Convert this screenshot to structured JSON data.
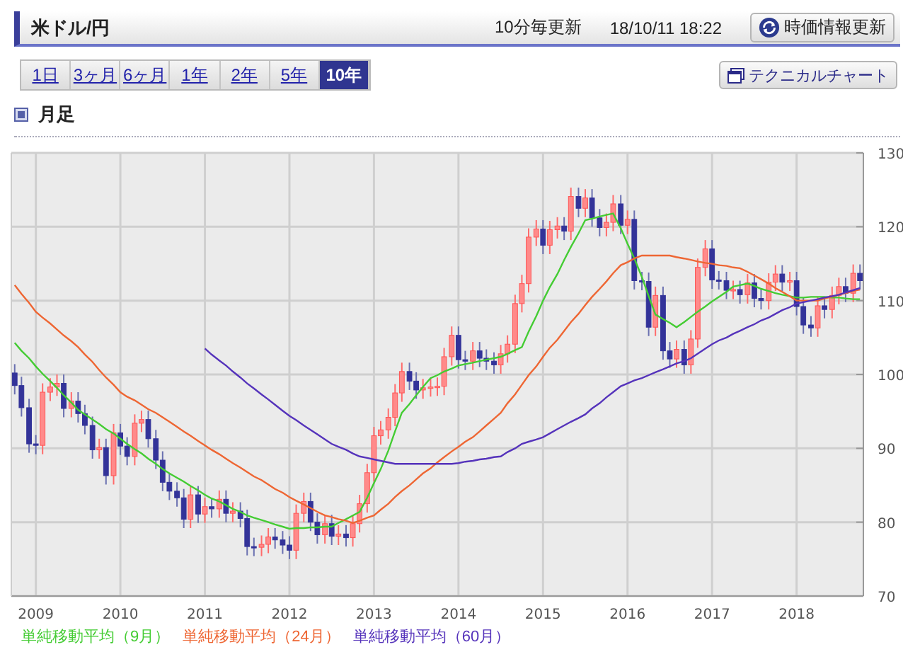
{
  "header": {
    "title": "米ドル/円",
    "update_interval": "10分毎更新",
    "timestamp": "18/10/11 18:22",
    "refresh_button": "時価情報更新"
  },
  "periods": [
    {
      "label": "1日",
      "selected": false
    },
    {
      "label": "3ヶ月",
      "selected": false
    },
    {
      "label": "6ヶ月",
      "selected": false
    },
    {
      "label": "1年",
      "selected": false
    },
    {
      "label": "2年",
      "selected": false
    },
    {
      "label": "5年",
      "selected": false
    },
    {
      "label": "10年",
      "selected": true
    }
  ],
  "technical_button": "テクニカルチャート",
  "section_title": "月足",
  "chart": {
    "chart_data": {
      "type": "candlestick",
      "grid": true,
      "xlim": [
        2008.71,
        2018.79
      ],
      "ylim": [
        70,
        130
      ],
      "xticks": [
        2009,
        2010,
        2011,
        2012,
        2013,
        2014,
        2015,
        2016,
        2017,
        2018
      ],
      "yticks": [
        70,
        80,
        90,
        100,
        110,
        120,
        130
      ],
      "x": [
        2008.75,
        2008.83,
        2008.92,
        2009,
        2009.08,
        2009.17,
        2009.25,
        2009.33,
        2009.42,
        2009.5,
        2009.58,
        2009.67,
        2009.75,
        2009.83,
        2009.92,
        2010,
        2010.08,
        2010.17,
        2010.25,
        2010.33,
        2010.42,
        2010.5,
        2010.58,
        2010.67,
        2010.75,
        2010.83,
        2010.92,
        2011,
        2011.08,
        2011.17,
        2011.25,
        2011.33,
        2011.42,
        2011.5,
        2011.58,
        2011.67,
        2011.75,
        2011.83,
        2011.92,
        2012,
        2012.08,
        2012.17,
        2012.25,
        2012.33,
        2012.42,
        2012.5,
        2012.58,
        2012.67,
        2012.75,
        2012.83,
        2012.92,
        2013,
        2013.08,
        2013.17,
        2013.25,
        2013.33,
        2013.42,
        2013.5,
        2013.58,
        2013.67,
        2013.75,
        2013.83,
        2013.92,
        2014,
        2014.08,
        2014.17,
        2014.25,
        2014.33,
        2014.42,
        2014.5,
        2014.58,
        2014.67,
        2014.75,
        2014.83,
        2014.92,
        2015,
        2015.08,
        2015.17,
        2015.25,
        2015.33,
        2015.42,
        2015.5,
        2015.58,
        2015.67,
        2015.75,
        2015.83,
        2015.92,
        2016,
        2016.08,
        2016.17,
        2016.25,
        2016.33,
        2016.42,
        2016.5,
        2016.58,
        2016.67,
        2016.75,
        2016.83,
        2016.92,
        2017,
        2017.08,
        2017.17,
        2017.25,
        2017.33,
        2017.42,
        2017.5,
        2017.58,
        2017.67,
        2017.75,
        2017.83,
        2017.92,
        2018,
        2018.08,
        2018.17,
        2018.25,
        2018.33,
        2018.42,
        2018.5,
        2018.58,
        2018.67,
        2018.75
      ],
      "ohlc": [
        [
          100.2,
          101.4,
          97.3,
          98.5
        ],
        [
          98.5,
          99.7,
          94.3,
          95.5
        ],
        [
          95.5,
          96.7,
          89.4,
          90.6
        ],
        [
          90.6,
          91.8,
          89.2,
          90.4
        ],
        [
          90.4,
          98.8,
          89.2,
          97.6
        ],
        [
          97.6,
          99.5,
          96.4,
          98.3
        ],
        [
          98.3,
          100.0,
          97.1,
          98.8
        ],
        [
          98.8,
          100.0,
          94.2,
          95.4
        ],
        [
          95.4,
          97.6,
          94.2,
          96.4
        ],
        [
          96.4,
          97.6,
          93.5,
          94.7
        ],
        [
          94.7,
          95.9,
          91.9,
          93.1
        ],
        [
          93.1,
          94.3,
          88.6,
          89.8
        ],
        [
          89.8,
          91.3,
          88.6,
          90.1
        ],
        [
          90.1,
          91.3,
          85.1,
          86.3
        ],
        [
          86.3,
          93.3,
          85.1,
          92.1
        ],
        [
          92.1,
          93.3,
          89.1,
          90.3
        ],
        [
          90.3,
          91.5,
          87.7,
          88.9
        ],
        [
          88.9,
          94.6,
          87.7,
          93.4
        ],
        [
          93.4,
          95.1,
          92.2,
          93.9
        ],
        [
          93.9,
          95.1,
          90.1,
          91.3
        ],
        [
          91.3,
          92.5,
          87.2,
          88.4
        ],
        [
          88.4,
          89.6,
          84.2,
          85.4
        ],
        [
          85.4,
          86.6,
          83.0,
          84.2
        ],
        [
          84.2,
          85.4,
          82.1,
          83.3
        ],
        [
          83.3,
          84.5,
          79.2,
          80.4
        ],
        [
          80.4,
          84.9,
          79.2,
          83.7
        ],
        [
          83.7,
          84.9,
          79.9,
          81.1
        ],
        [
          81.1,
          83.3,
          79.9,
          82.1
        ],
        [
          82.1,
          83.3,
          80.6,
          81.8
        ],
        [
          81.8,
          84.3,
          80.6,
          83.1
        ],
        [
          83.1,
          84.3,
          80.0,
          81.2
        ],
        [
          81.2,
          82.7,
          80.0,
          81.5
        ],
        [
          81.5,
          82.7,
          79.3,
          80.5
        ],
        [
          80.5,
          81.7,
          75.5,
          76.7
        ],
        [
          76.7,
          77.9,
          75.4,
          76.6
        ],
        [
          76.6,
          78.2,
          75.4,
          77.0
        ],
        [
          77.0,
          79.2,
          75.8,
          78.0
        ],
        [
          78.0,
          79.2,
          76.4,
          77.6
        ],
        [
          77.6,
          78.8,
          75.7,
          76.9
        ],
        [
          76.9,
          78.1,
          75.0,
          76.2
        ],
        [
          76.2,
          82.4,
          75.0,
          81.2
        ],
        [
          81.2,
          84.0,
          80.0,
          82.8
        ],
        [
          82.8,
          84.0,
          78.8,
          80.0
        ],
        [
          80.0,
          81.2,
          77.1,
          78.3
        ],
        [
          78.3,
          81.0,
          77.1,
          79.8
        ],
        [
          79.8,
          81.0,
          76.9,
          78.1
        ],
        [
          78.1,
          79.6,
          76.9,
          78.4
        ],
        [
          78.4,
          79.6,
          76.7,
          77.9
        ],
        [
          77.9,
          81.0,
          76.7,
          79.8
        ],
        [
          79.8,
          83.7,
          78.6,
          82.5
        ],
        [
          82.5,
          87.9,
          81.3,
          86.7
        ],
        [
          86.7,
          92.9,
          85.5,
          91.7
        ],
        [
          91.7,
          93.7,
          90.5,
          92.5
        ],
        [
          92.5,
          95.4,
          91.3,
          94.2
        ],
        [
          94.2,
          98.7,
          93.0,
          97.5
        ],
        [
          97.5,
          101.6,
          96.3,
          100.4
        ],
        [
          100.4,
          101.6,
          97.9,
          99.1
        ],
        [
          99.1,
          100.3,
          96.7,
          97.9
        ],
        [
          97.9,
          99.4,
          96.7,
          98.2
        ],
        [
          98.2,
          99.5,
          97.0,
          98.3
        ],
        [
          98.3,
          99.6,
          97.1,
          98.4
        ],
        [
          98.4,
          103.6,
          97.2,
          102.4
        ],
        [
          102.4,
          106.5,
          101.2,
          105.3
        ],
        [
          105.3,
          106.5,
          100.8,
          102.0
        ],
        [
          102.0,
          103.2,
          100.6,
          101.8
        ],
        [
          101.8,
          104.4,
          100.6,
          103.2
        ],
        [
          103.2,
          104.4,
          101.0,
          102.2
        ],
        [
          102.2,
          103.4,
          100.6,
          101.8
        ],
        [
          101.8,
          103.0,
          100.1,
          101.3
        ],
        [
          101.3,
          104.0,
          100.1,
          102.8
        ],
        [
          102.8,
          105.3,
          101.6,
          104.1
        ],
        [
          104.1,
          110.8,
          102.9,
          109.6
        ],
        [
          109.6,
          113.5,
          108.4,
          112.3
        ],
        [
          112.3,
          119.8,
          111.1,
          118.6
        ],
        [
          118.6,
          120.9,
          117.4,
          119.7
        ],
        [
          119.7,
          120.9,
          116.3,
          117.5
        ],
        [
          117.5,
          120.8,
          116.3,
          119.6
        ],
        [
          119.6,
          121.3,
          118.4,
          120.1
        ],
        [
          120.1,
          121.3,
          118.2,
          119.4
        ],
        [
          119.4,
          125.3,
          118.2,
          124.1
        ],
        [
          124.1,
          125.3,
          121.3,
          122.5
        ],
        [
          122.5,
          125.1,
          121.3,
          123.9
        ],
        [
          123.9,
          125.1,
          120.0,
          121.2
        ],
        [
          121.2,
          122.4,
          118.7,
          119.9
        ],
        [
          119.9,
          121.8,
          118.7,
          120.6
        ],
        [
          120.6,
          124.3,
          119.4,
          123.1
        ],
        [
          123.1,
          124.3,
          119.0,
          120.2
        ],
        [
          120.2,
          122.2,
          119.0,
          121.0
        ],
        [
          121.0,
          122.2,
          111.5,
          112.7
        ],
        [
          112.7,
          113.9,
          111.4,
          112.6
        ],
        [
          112.6,
          113.8,
          105.2,
          106.4
        ],
        [
          106.4,
          111.9,
          105.2,
          110.7
        ],
        [
          110.7,
          111.9,
          102.0,
          103.2
        ],
        [
          103.2,
          104.4,
          100.9,
          102.1
        ],
        [
          102.1,
          104.6,
          100.9,
          103.4
        ],
        [
          103.4,
          104.6,
          100.1,
          101.3
        ],
        [
          101.3,
          106.0,
          100.1,
          104.8
        ],
        [
          104.8,
          115.7,
          103.6,
          114.5
        ],
        [
          114.5,
          118.2,
          113.3,
          117.0
        ],
        [
          117.0,
          118.2,
          111.6,
          112.8
        ],
        [
          112.8,
          114.0,
          111.5,
          112.7
        ],
        [
          112.7,
          113.9,
          110.2,
          111.4
        ],
        [
          111.4,
          112.7,
          110.2,
          111.5
        ],
        [
          111.5,
          112.7,
          109.6,
          110.8
        ],
        [
          110.8,
          113.6,
          109.6,
          112.4
        ],
        [
          112.4,
          113.6,
          109.1,
          110.3
        ],
        [
          110.3,
          111.5,
          108.8,
          110.0
        ],
        [
          110.0,
          113.7,
          108.8,
          112.5
        ],
        [
          112.5,
          114.8,
          111.3,
          113.6
        ],
        [
          113.6,
          114.8,
          111.3,
          112.5
        ],
        [
          112.5,
          113.9,
          111.3,
          112.7
        ],
        [
          112.7,
          113.9,
          108.0,
          109.2
        ],
        [
          109.2,
          110.4,
          105.5,
          106.7
        ],
        [
          106.7,
          107.9,
          105.1,
          106.3
        ],
        [
          106.3,
          110.5,
          105.1,
          109.3
        ],
        [
          109.3,
          110.5,
          107.6,
          108.8
        ],
        [
          108.8,
          111.9,
          107.6,
          110.7
        ],
        [
          110.7,
          113.1,
          109.5,
          111.9
        ],
        [
          111.9,
          113.1,
          109.8,
          111.0
        ],
        [
          111.0,
          114.9,
          109.8,
          113.7
        ],
        [
          113.7,
          114.9,
          111.5,
          112.7
        ]
      ]
    }
  },
  "moving_averages": {
    "chart_data": {
      "type": "line",
      "xlim": [
        2008.71,
        2018.79
      ],
      "ylim": [
        70,
        130
      ],
      "x": [
        2008.75,
        2008.83,
        2008.92,
        2009,
        2009.08,
        2009.17,
        2009.25,
        2009.33,
        2009.42,
        2009.5,
        2009.58,
        2009.67,
        2009.75,
        2009.83,
        2009.92,
        2010,
        2010.08,
        2010.17,
        2010.25,
        2010.33,
        2010.42,
        2010.5,
        2010.58,
        2010.67,
        2010.75,
        2010.83,
        2010.92,
        2011,
        2011.08,
        2011.17,
        2011.25,
        2011.33,
        2011.42,
        2011.5,
        2011.58,
        2011.67,
        2011.75,
        2011.83,
        2011.92,
        2012,
        2012.08,
        2012.17,
        2012.25,
        2012.33,
        2012.42,
        2012.5,
        2012.58,
        2012.67,
        2012.75,
        2012.83,
        2012.92,
        2013,
        2013.08,
        2013.17,
        2013.25,
        2013.33,
        2013.42,
        2013.5,
        2013.58,
        2013.67,
        2013.75,
        2013.83,
        2013.92,
        2014,
        2014.08,
        2014.17,
        2014.25,
        2014.33,
        2014.42,
        2014.5,
        2014.58,
        2014.67,
        2014.75,
        2014.83,
        2014.92,
        2015,
        2015.08,
        2015.17,
        2015.25,
        2015.33,
        2015.42,
        2015.5,
        2015.58,
        2015.67,
        2015.75,
        2015.83,
        2015.92,
        2016,
        2016.08,
        2016.17,
        2016.25,
        2016.33,
        2016.42,
        2016.5,
        2016.58,
        2016.67,
        2016.75,
        2016.83,
        2016.92,
        2017,
        2017.08,
        2017.17,
        2017.25,
        2017.33,
        2017.42,
        2017.5,
        2017.58,
        2017.67,
        2017.75,
        2017.83,
        2017.92,
        2018,
        2018.08,
        2018.17,
        2018.25,
        2018.33,
        2018.42,
        2018.5,
        2018.58,
        2018.67,
        2018.75
      ],
      "series": [
        {
          "name": "単純移動平均（9月）",
          "color": "#44cc33",
          "values": [
            104.3,
            103.2,
            102.2,
            101.1,
            100.1,
            99.1,
            98.2,
            97.2,
            96.2,
            95.2,
            94.6,
            93.9,
            93.3,
            92.6,
            92.0,
            91.3,
            90.6,
            89.9,
            89.3,
            88.6,
            87.9,
            87.2,
            86.6,
            86.0,
            85.5,
            84.9,
            84.3,
            83.7,
            83.2,
            82.8,
            82.3,
            81.8,
            81.4,
            80.9,
            80.6,
            80.3,
            80.0,
            79.7,
            79.4,
            79.1,
            79.2,
            79.2,
            79.3,
            79.3,
            79.4,
            79.4,
            79.9,
            80.4,
            80.9,
            81.4,
            83.3,
            85.3,
            87.2,
            89.7,
            92.3,
            94.8,
            96.0,
            97.2,
            98.3,
            99.5,
            99.9,
            100.4,
            100.8,
            101.2,
            101.4,
            101.6,
            101.8,
            102.0,
            102.2,
            102.4,
            102.8,
            103.3,
            103.7,
            105.8,
            107.9,
            110.0,
            111.8,
            113.6,
            115.5,
            117.3,
            119.1,
            120.9,
            121.1,
            121.4,
            121.6,
            121.8,
            119.8,
            117.7,
            115.7,
            113.2,
            110.6,
            108.1,
            107.5,
            107.0,
            106.4,
            107.1,
            107.8,
            108.5,
            109.2,
            109.9,
            110.5,
            111.2,
            111.9,
            112.1,
            112.3,
            112.0,
            111.6,
            111.3,
            111.0,
            110.8,
            110.6,
            110.4,
            110.4,
            110.5,
            110.5,
            110.5,
            110.4,
            110.4,
            110.3,
            110.2,
            110.2
          ]
        },
        {
          "name": "単純移動平均（24月）",
          "color": "#ee6633",
          "values": [
            112.1,
            110.9,
            109.7,
            108.5,
            107.7,
            106.9,
            106.1,
            105.3,
            104.5,
            103.7,
            102.7,
            101.7,
            100.6,
            99.6,
            98.6,
            97.6,
            97.0,
            96.5,
            95.9,
            95.3,
            94.8,
            94.2,
            93.6,
            92.9,
            92.3,
            91.7,
            91.0,
            90.4,
            89.8,
            89.2,
            88.6,
            88.0,
            87.4,
            86.8,
            86.2,
            85.7,
            85.1,
            84.5,
            84.0,
            83.4,
            82.9,
            82.4,
            81.9,
            81.4,
            80.9,
            80.7,
            80.4,
            80.2,
            79.9,
            80.2,
            80.6,
            80.9,
            81.7,
            82.5,
            83.4,
            84.2,
            85.0,
            85.8,
            86.6,
            87.3,
            88.1,
            88.8,
            89.6,
            90.2,
            90.9,
            91.5,
            92.3,
            93.1,
            94.0,
            94.8,
            96.1,
            97.3,
            98.6,
            99.9,
            101.1,
            102.4,
            103.6,
            104.7,
            105.9,
            107.1,
            108.2,
            109.4,
            110.5,
            111.6,
            112.6,
            113.7,
            114.8,
            115.2,
            115.7,
            116.1,
            116.1,
            116.1,
            116.1,
            116.1,
            115.9,
            115.7,
            115.5,
            115.3,
            115.1,
            115.0,
            114.8,
            114.7,
            114.5,
            114.4,
            113.9,
            113.4,
            112.9,
            112.3,
            111.7,
            111.2,
            110.6,
            110.0,
            110.0,
            110.0,
            110.0,
            110.3,
            110.5,
            110.8,
            111.0,
            111.3,
            111.5
          ]
        },
        {
          "name": "単純移動平均（60月）",
          "color": "#5533bb",
          "values": [
            null,
            null,
            null,
            null,
            null,
            null,
            null,
            null,
            null,
            null,
            null,
            null,
            null,
            null,
            null,
            null,
            null,
            null,
            null,
            null,
            null,
            null,
            null,
            null,
            null,
            null,
            null,
            103.5,
            102.7,
            101.9,
            101.2,
            100.4,
            99.6,
            98.8,
            98.1,
            97.3,
            96.6,
            95.9,
            95.1,
            94.4,
            93.8,
            93.1,
            92.5,
            91.9,
            91.2,
            90.6,
            90.2,
            89.8,
            89.3,
            88.9,
            88.7,
            88.5,
            88.3,
            88.1,
            87.9,
            87.9,
            87.9,
            87.9,
            87.9,
            87.9,
            87.9,
            87.9,
            87.9,
            88.0,
            88.2,
            88.3,
            88.5,
            88.6,
            88.8,
            88.9,
            89.5,
            90.0,
            90.6,
            90.9,
            91.2,
            91.5,
            92.0,
            92.6,
            93.1,
            93.6,
            94.1,
            94.6,
            95.4,
            96.1,
            96.9,
            97.6,
            98.4,
            98.8,
            99.2,
            99.5,
            99.9,
            100.3,
            100.7,
            101.1,
            101.5,
            101.8,
            102.2,
            102.8,
            103.5,
            104.1,
            104.6,
            105.0,
            105.5,
            105.9,
            106.4,
            106.8,
            107.3,
            107.7,
            108.2,
            108.7,
            109.1,
            109.6,
            109.8,
            110.0,
            110.2,
            110.4,
            110.6,
            110.8,
            111.1,
            111.4,
            111.7
          ]
        }
      ]
    }
  }
}
